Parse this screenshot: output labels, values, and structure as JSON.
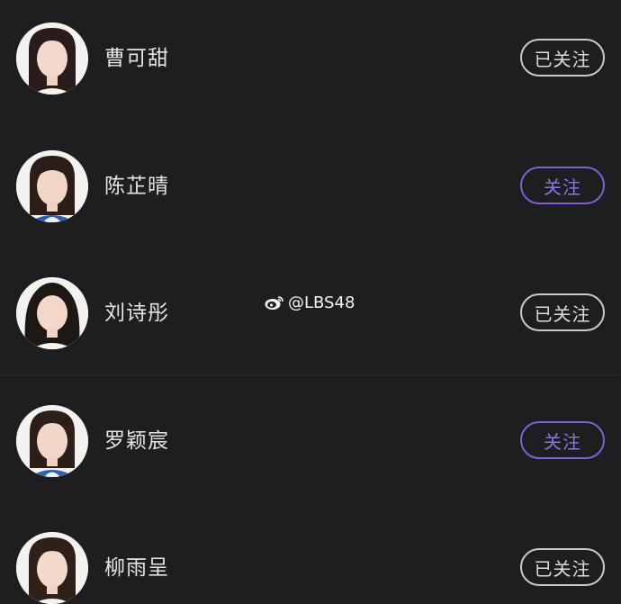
{
  "members": [
    {
      "name": "曹可甜",
      "follow_label": "已关注",
      "followed": true,
      "hair": "#2a1c1a"
    },
    {
      "name": "陈芷晴",
      "follow_label": "关注",
      "followed": false,
      "hair": "#2b1d17"
    },
    {
      "name": "刘诗彤",
      "follow_label": "已关注",
      "followed": true,
      "hair": "#1f1714"
    },
    {
      "name": "罗颖宸",
      "follow_label": "关注",
      "followed": false,
      "hair": "#2c1e18"
    },
    {
      "name": "柳雨呈",
      "follow_label": "已关注",
      "followed": true,
      "hair": "#2f2119"
    }
  ],
  "watermark": {
    "text": "@LBS48",
    "icon": "weibo-icon"
  },
  "colors": {
    "background": "#1e1e21",
    "name_text": "#e4e4e6",
    "followed_border": "#c9c9cc",
    "follow_accent": "#7c62d6"
  }
}
